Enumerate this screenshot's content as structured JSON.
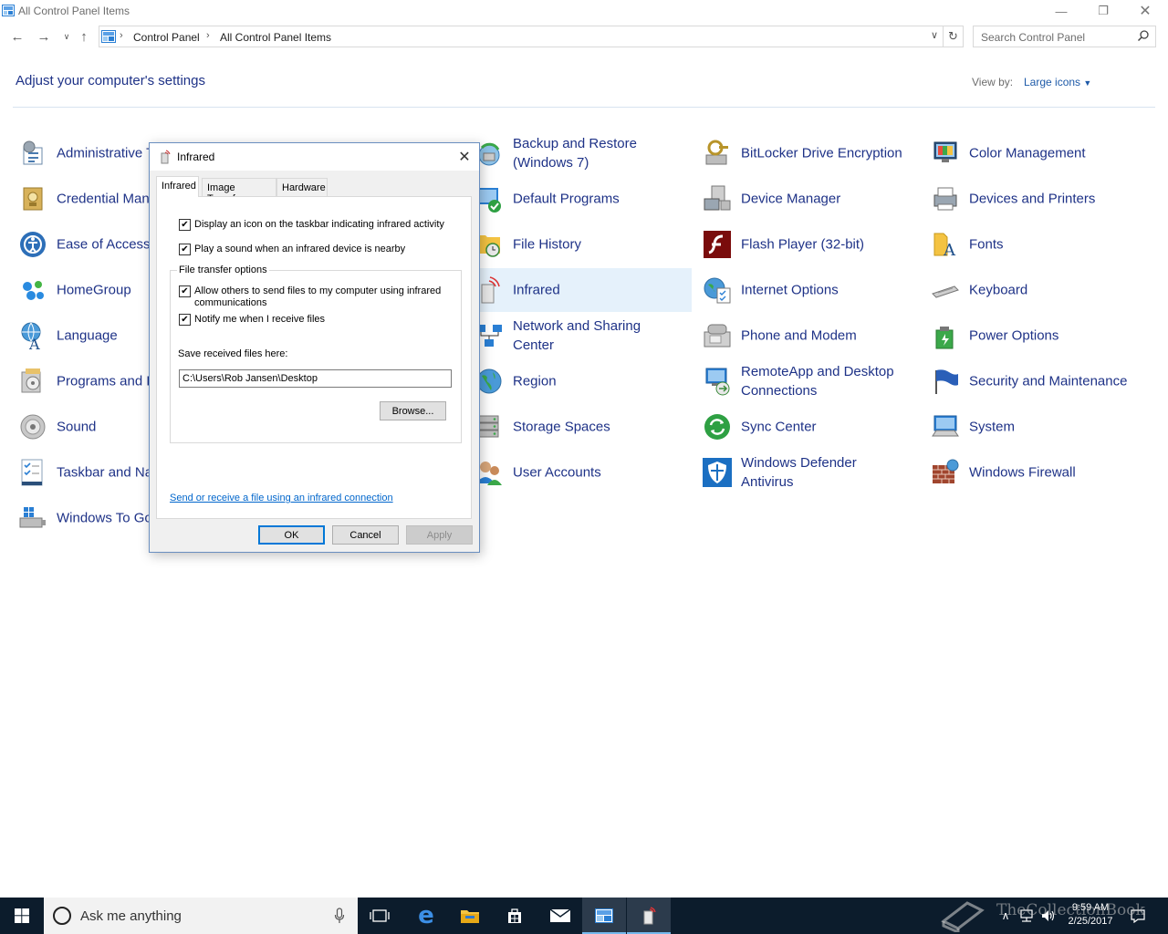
{
  "window": {
    "title": "All Control Panel Items",
    "minimize_icon": "minimize-icon",
    "restore_icon": "restore-icon",
    "close_icon": "close-icon"
  },
  "address_bar": {
    "crumbs": [
      "Control Panel",
      "All Control Panel Items"
    ],
    "search_placeholder": "Search Control Panel"
  },
  "header": {
    "title": "Adjust your computer's settings",
    "view_by_label": "View by:",
    "view_by_value": "Large icons"
  },
  "items": [
    {
      "label": "Administrative Tools",
      "icon": "admin-tools-icon"
    },
    {
      "label": "Credential Manager",
      "icon": "credential-manager-icon"
    },
    {
      "label": "Ease of Access Center",
      "icon": "ease-of-access-icon"
    },
    {
      "label": "HomeGroup",
      "icon": "homegroup-icon"
    },
    {
      "label": "Language",
      "icon": "language-icon"
    },
    {
      "label": "Programs and Features",
      "icon": "programs-icon"
    },
    {
      "label": "Sound",
      "icon": "sound-icon"
    },
    {
      "label": "Taskbar and Navigation",
      "icon": "taskbar-icon"
    },
    {
      "label": "Windows To Go",
      "icon": "windows-to-go-icon"
    },
    {
      "label": "Backup and Restore\n(Windows 7)",
      "icon": "backup-icon"
    },
    {
      "label": "Default Programs",
      "icon": "default-programs-icon"
    },
    {
      "label": "File History",
      "icon": "file-history-icon"
    },
    {
      "label": "Infrared",
      "icon": "infrared-icon"
    },
    {
      "label": "Network and Sharing\nCenter",
      "icon": "network-icon"
    },
    {
      "label": "Region",
      "icon": "region-icon"
    },
    {
      "label": "Storage Spaces",
      "icon": "storage-icon"
    },
    {
      "label": "User Accounts",
      "icon": "user-accounts-icon"
    },
    {
      "label": "BitLocker Drive Encryption",
      "icon": "bitlocker-icon"
    },
    {
      "label": "Device Manager",
      "icon": "device-manager-icon"
    },
    {
      "label": "Flash Player (32-bit)",
      "icon": "flash-icon"
    },
    {
      "label": "Internet Options",
      "icon": "internet-options-icon"
    },
    {
      "label": "Phone and Modem",
      "icon": "phone-icon"
    },
    {
      "label": "RemoteApp and Desktop\nConnections",
      "icon": "remoteapp-icon"
    },
    {
      "label": "Sync Center",
      "icon": "sync-icon"
    },
    {
      "label": "Windows Defender\nAntivirus",
      "icon": "defender-icon"
    },
    {
      "label": "Color Management",
      "icon": "color-management-icon"
    },
    {
      "label": "Devices and Printers",
      "icon": "printers-icon"
    },
    {
      "label": "Fonts",
      "icon": "fonts-icon"
    },
    {
      "label": "Keyboard",
      "icon": "keyboard-icon"
    },
    {
      "label": "Power Options",
      "icon": "power-icon"
    },
    {
      "label": "Security and Maintenance",
      "icon": "security-icon"
    },
    {
      "label": "System",
      "icon": "system-icon"
    },
    {
      "label": "Windows Firewall",
      "icon": "firewall-icon"
    }
  ],
  "dialog": {
    "title": "Infrared",
    "tabs": [
      "Infrared",
      "Image Transfer",
      "Hardware"
    ],
    "active_tab": "Infrared",
    "checkbox_taskbar": {
      "label": "Display an icon on the taskbar indicating infrared activity",
      "checked": true
    },
    "checkbox_sound": {
      "label": "Play a sound when an infrared device is nearby",
      "checked": true
    },
    "group_title": "File transfer options",
    "checkbox_allow": {
      "label": "Allow others to send files to my computer using infrared\ncommunications",
      "checked": true
    },
    "checkbox_notify": {
      "label": "Notify me when I receive files",
      "checked": true
    },
    "save_label": "Save received files here:",
    "save_path": "C:\\Users\\Rob Jansen\\Desktop",
    "browse_label": "Browse...",
    "link_text": "Send or receive a file using an infrared connection",
    "ok_label": "OK",
    "cancel_label": "Cancel",
    "apply_label": "Apply"
  },
  "taskbar": {
    "search_text": "Ask me anything",
    "time": "9:59 AM",
    "date": "2/25/2017",
    "watermark": "TheCollectionBook"
  },
  "colors": {
    "link": "#1e3287",
    "accent": "#0078d7",
    "taskbar": "#0c1c2c",
    "selected": "#e5f1fb"
  }
}
